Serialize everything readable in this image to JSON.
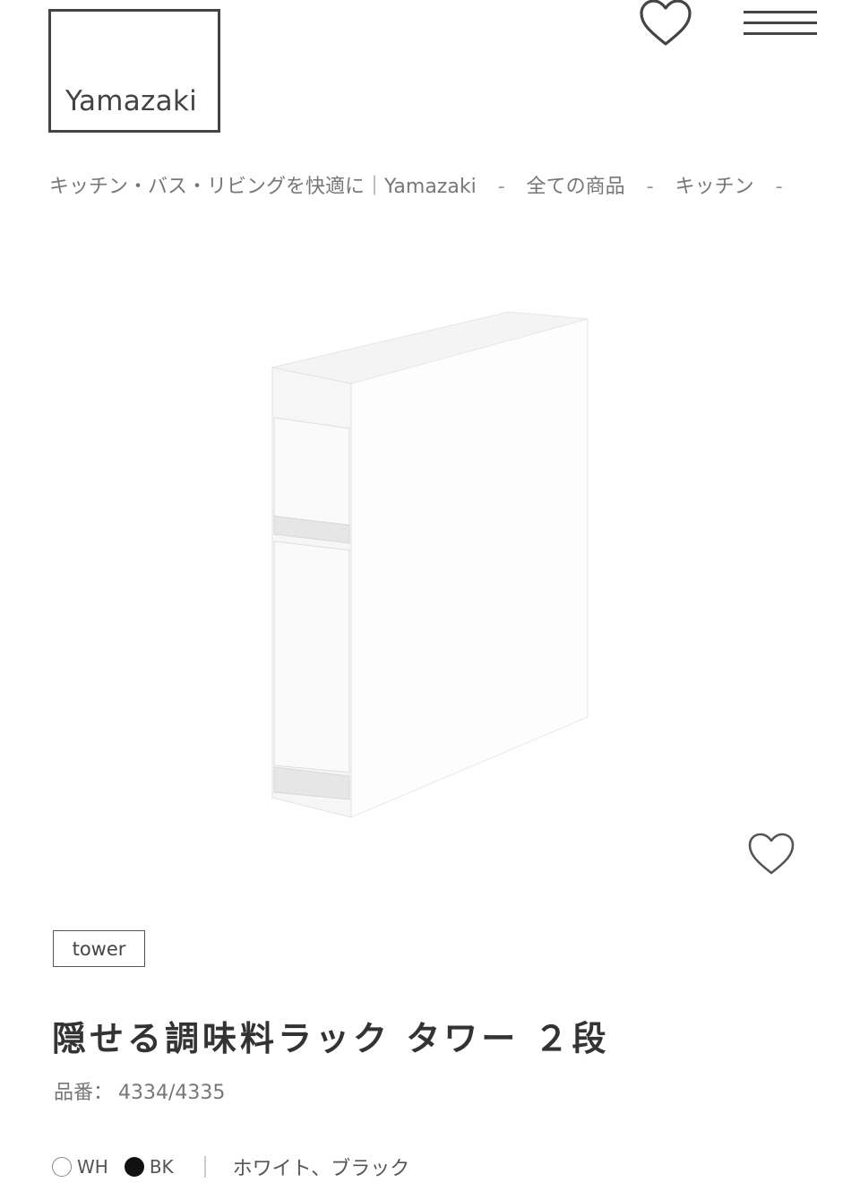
{
  "header": {
    "logo_text": "Yamazaki",
    "favorites_icon": "heart-icon",
    "menu_icon": "hamburger-menu-icon"
  },
  "breadcrumb": {
    "items": [
      "キッチン・バス・リビングを快適に｜Yamazaki",
      "全ての商品",
      "キッチン"
    ],
    "separator": "-"
  },
  "product": {
    "brand_tag": "tower",
    "title": "隠せる調味料ラック タワー ２段",
    "code_label": "品番：",
    "code_value": "4334/4335",
    "favorite_icon": "heart-icon",
    "colors": [
      {
        "code": "WH",
        "hex": "#ffffff"
      },
      {
        "code": "BK",
        "hex": "#111111"
      }
    ],
    "color_divider": "|",
    "color_names": "ホワイト、ブラック"
  }
}
